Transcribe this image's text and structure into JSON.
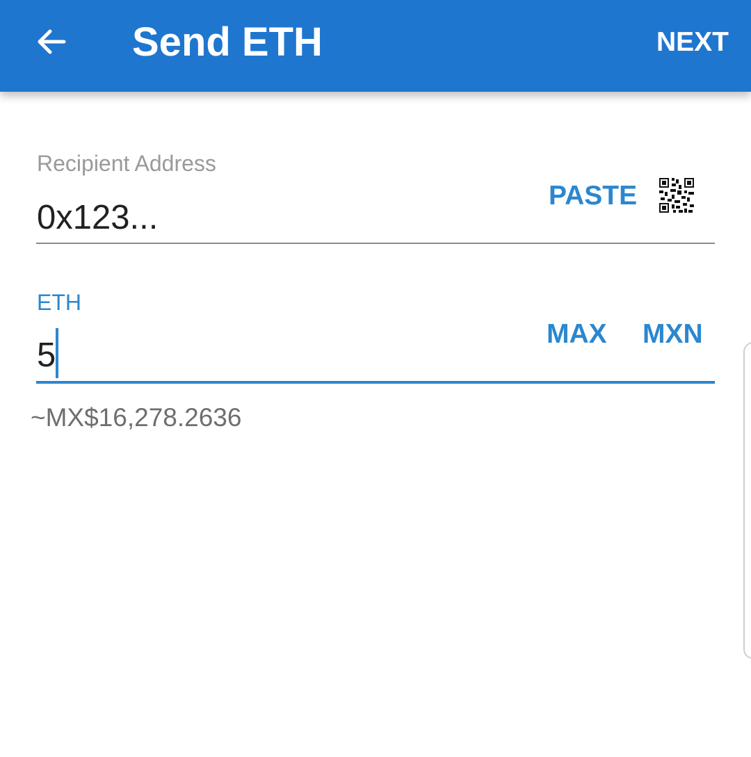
{
  "appbar": {
    "back_icon": "arrow-back-icon",
    "title": "Send ETH",
    "next_label": "NEXT",
    "color": "#1f76cf"
  },
  "recipient": {
    "label": "Recipient Address",
    "value": "0x123...",
    "paste_label": "PASTE",
    "qr_icon": "qr-code-icon"
  },
  "amount": {
    "label": "ETH",
    "value": "5",
    "max_label": "MAX",
    "currency_label": "MXN",
    "converted": "~MX$16,278.2636",
    "accent_color": "#2b87cf"
  }
}
